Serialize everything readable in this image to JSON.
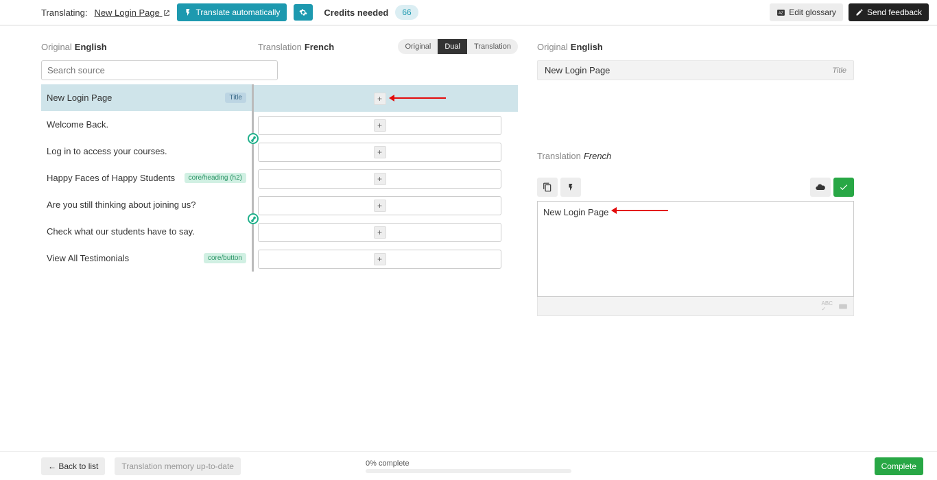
{
  "topbar": {
    "translating_label": "Translating:",
    "translating_link": "New Login Page",
    "translate_auto": "Translate automatically",
    "credits_label": "Credits needed",
    "credits_value": "66",
    "edit_glossary": "Edit glossary",
    "send_feedback": "Send feedback"
  },
  "columns": {
    "original_label": "Original",
    "original_lang": "English",
    "translation_label": "Translation",
    "translation_lang": "French",
    "search_placeholder": "Search source"
  },
  "view_toggle": {
    "original": "Original",
    "dual": "Dual",
    "translation": "Translation"
  },
  "rows": [
    {
      "text": "New Login Page",
      "tag": "Title",
      "tag_style": "blue",
      "selected": true
    },
    {
      "text": "Welcome Back."
    },
    {
      "text": "Log in to access your courses."
    },
    {
      "text": "Happy Faces of Happy Students",
      "tag": "core/heading (h2)",
      "tag_style": "green"
    },
    {
      "text": "Are you still thinking about joining us?"
    },
    {
      "text": "Check what our students have to say."
    },
    {
      "text": "View All Testimonials",
      "tag": "core/button",
      "tag_style": "green"
    }
  ],
  "right_panel": {
    "original_text": "New Login Page",
    "type_label": "Title",
    "translation_text": "New Login Page"
  },
  "footer": {
    "back": "← Back to list",
    "tm_status": "Translation memory up-to-date",
    "progress_label": "0% complete",
    "complete": "Complete"
  },
  "editor_footer": {
    "abc": "ABC"
  }
}
